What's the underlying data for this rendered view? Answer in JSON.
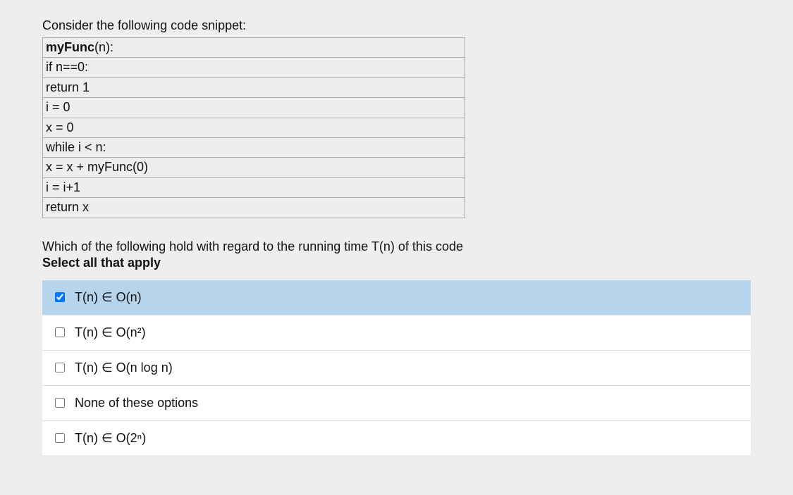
{
  "prompt": "Consider the following code snippet:",
  "code": {
    "fn_name": "myFunc",
    "fn_arg_open": "(",
    "fn_arg": "n",
    "fn_arg_close": "):",
    "lines": [
      {
        "indent": 1,
        "text": "if n==0:"
      },
      {
        "indent": 2,
        "text": "return 1"
      },
      {
        "indent": 1,
        "text": "i = 0"
      },
      {
        "indent": 1,
        "text": "x = 0"
      },
      {
        "indent": 1,
        "text": "while i < n:"
      },
      {
        "indent": 2,
        "text": "x = x + myFunc(0)"
      },
      {
        "indent": 2,
        "text": "i = i+1"
      },
      {
        "indent": 1,
        "text": "return x"
      }
    ]
  },
  "question": "Which of the following hold with regard to the running time T(n) of this code",
  "instruction": "Select all that apply",
  "options": [
    {
      "label_html": "T(n) ∈ O(n)",
      "checked": true
    },
    {
      "label_html": "T(n) ∈ O(n²)",
      "checked": false
    },
    {
      "label_html": "T(n) ∈ O(n log n)",
      "checked": false
    },
    {
      "label_html": "None of these options",
      "checked": false
    },
    {
      "label_html": "T(n) ∈ O(2ⁿ)",
      "checked": false
    }
  ]
}
